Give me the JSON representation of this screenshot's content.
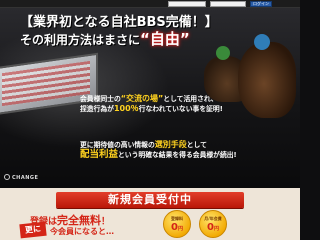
{
  "topbar": {
    "field1_text": "",
    "field2_text": "",
    "login_label": "ログイン"
  },
  "hero": {
    "headline": "【業界初となる自社BBS完備！】",
    "headline2_prefix": "その利用方法はまさに",
    "headline2_highlight": "“自由”",
    "line1_a": "会員様同士の",
    "line1_hl": "“交流の場”",
    "line1_b": "として活用され、",
    "line2_a": "捏造行為が",
    "line2_hl": "100％",
    "line2_b": "行なわれていない事を証明!",
    "line3_a": "更に期待値の高い情報の",
    "line3_hl": "選別手段",
    "line3_b": "として",
    "line4_hl": "配当利益",
    "line4_b": "という明確な結果を得る会員様が続出!"
  },
  "brand": {
    "name": "CHANGE"
  },
  "registration": {
    "banner": "新規会員受付中",
    "line1_a": "登録は",
    "line1_b": "完全無料",
    "line1_c": "！",
    "sarani": "更に",
    "line2": "今会員になると…",
    "badge1_label": "登録料",
    "badge1_value": "0",
    "badge2_label": "月/年会費",
    "badge2_value": "0",
    "yen": "円"
  },
  "colors": {
    "accent_red": "#d42517",
    "highlight_yellow": "#ffd21f",
    "login_blue": "#2b5ea8"
  }
}
